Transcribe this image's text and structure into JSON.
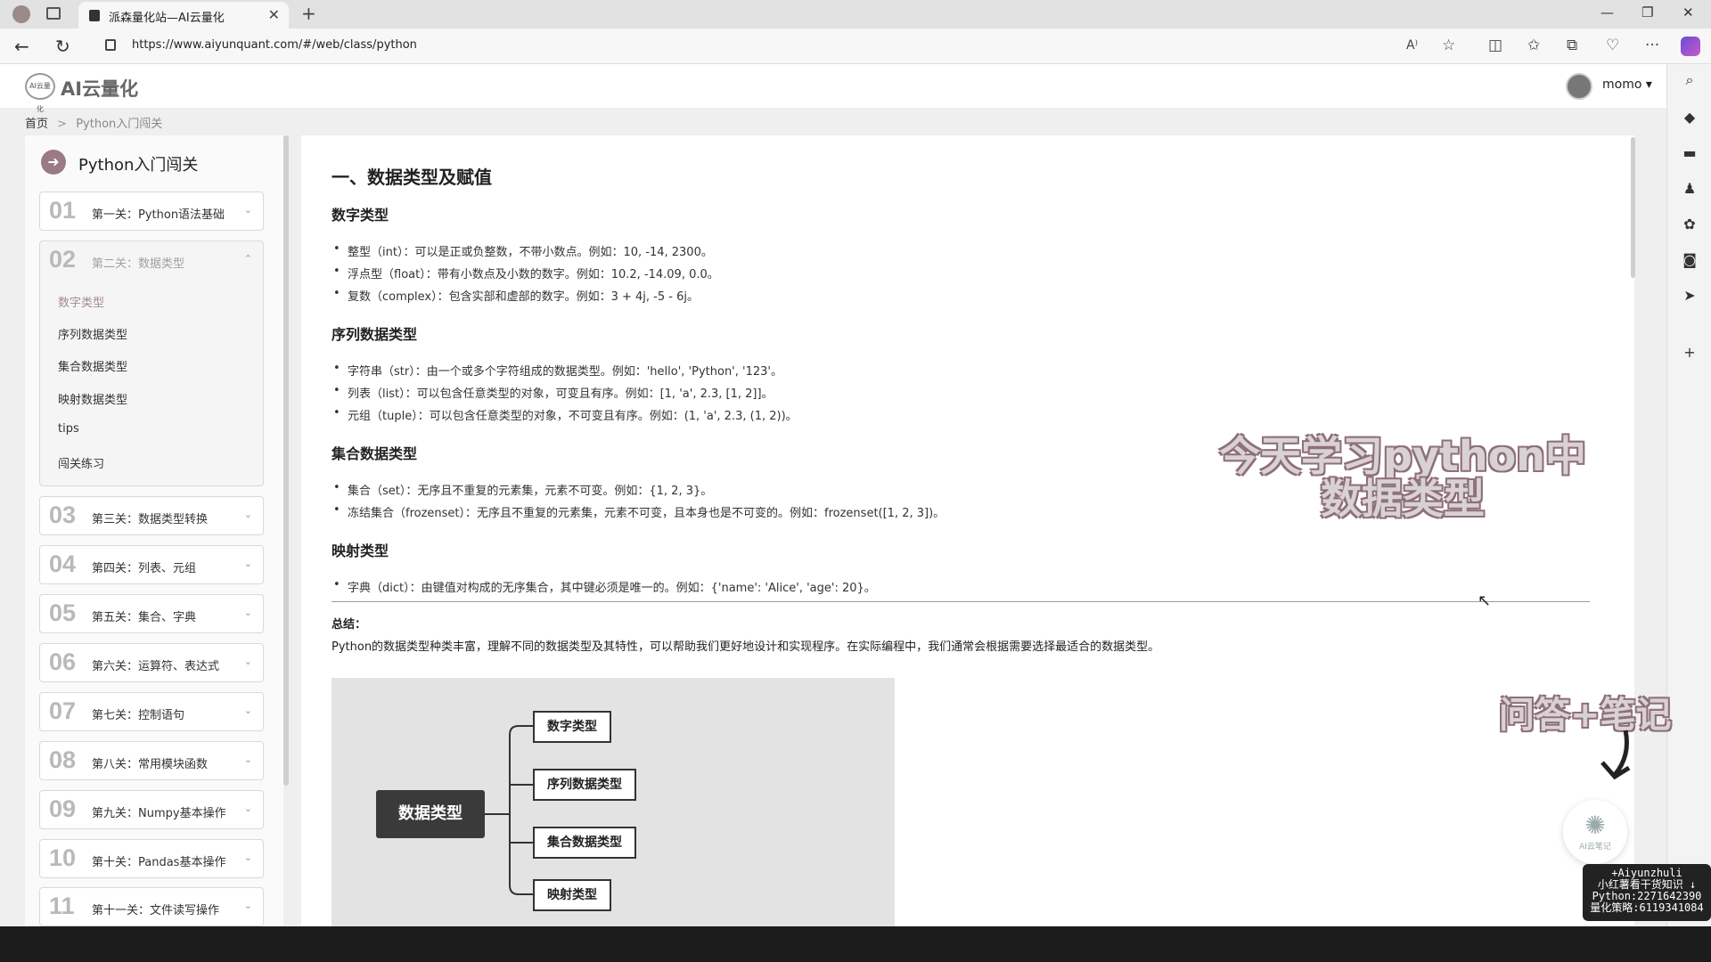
{
  "browser": {
    "tab_title": "派森量化站—AI云量化",
    "tab_close": "✕",
    "new_tab": "+",
    "url": "https://www.aiyunquant.com/#/web/class/python",
    "win_min": "—",
    "win_max": "❐",
    "win_close": "✕",
    "read_aloud": "A⁾",
    "more": "···"
  },
  "site": {
    "logo_badge": "AI云量化",
    "logo_text": "AI云量化",
    "user_name": "momo ▾"
  },
  "breadcrumb": {
    "home": "首页",
    "sep": ">",
    "current": "Python入门闯关"
  },
  "sidebar": {
    "course_title": "Python入门闯关",
    "course_arrow": "➜",
    "levels": [
      {
        "num": "01",
        "label": "第一关：Python语法基础",
        "chev": "⌄"
      },
      {
        "num": "02",
        "label": "第二关：数据类型",
        "chev": "⌃"
      },
      {
        "num": "03",
        "label": "第三关：数据类型转换",
        "chev": "⌄"
      },
      {
        "num": "04",
        "label": "第四关：列表、元组",
        "chev": "⌄"
      },
      {
        "num": "05",
        "label": "第五关：集合、字典",
        "chev": "⌄"
      },
      {
        "num": "06",
        "label": "第六关：运算符、表达式",
        "chev": "⌄"
      },
      {
        "num": "07",
        "label": "第七关：控制语句",
        "chev": "⌄"
      },
      {
        "num": "08",
        "label": "第八关：常用模块函数",
        "chev": "⌄"
      },
      {
        "num": "09",
        "label": "第九关：Numpy基本操作",
        "chev": "⌄"
      },
      {
        "num": "10",
        "label": "第十关：Pandas基本操作",
        "chev": "⌄"
      },
      {
        "num": "11",
        "label": "第十一关：文件读写操作",
        "chev": "⌄"
      }
    ],
    "subitems": [
      "数字类型",
      "序列数据类型",
      "集合数据类型",
      "映射数据类型",
      "tips",
      "闯关练习"
    ]
  },
  "content": {
    "h1": "一、数据类型及赋值",
    "sections": [
      {
        "title": "数字类型",
        "items": [
          "整型（int）：可以是正或负整数，不带小数点。例如：10, -14, 2300。",
          "浮点型（float）：带有小数点及小数的数字。例如：10.2, -14.09, 0.0。",
          "复数（complex）：包含实部和虚部的数字。例如：3 + 4j, -5 - 6j。"
        ]
      },
      {
        "title": "序列数据类型",
        "items": [
          "字符串（str）：由一个或多个字符组成的数据类型。例如：'hello', 'Python', '123'。",
          "列表（list）：可以包含任意类型的对象，可变且有序。例如：[1, 'a', 2.3, [1, 2]]。",
          "元组（tuple）：可以包含任意类型的对象，不可变且有序。例如：(1, 'a', 2.3, (1, 2))。"
        ]
      },
      {
        "title": "集合数据类型",
        "items": [
          "集合（set）：无序且不重复的元素集，元素不可变。例如：{1, 2, 3}。",
          "冻结集合（frozenset）：无序且不重复的元素集，元素不可变，且本身也是不可变的。例如：frozenset([1, 2, 3])。"
        ]
      },
      {
        "title": "映射类型",
        "items": [
          "字典（dict）：由键值对构成的无序集合，其中键必须是唯一的。例如：{'name': 'Alice', 'age': 20}。"
        ]
      }
    ],
    "summary_label": "总结：",
    "summary_text": "Python的数据类型种类丰富，理解不同的数据类型及其特性，可以帮助我们更好地设计和实现程序。在实际编程中，我们通常会根据需要选择最适合的数据类型。",
    "diagram": {
      "root": "数据类型",
      "children": [
        "数字类型",
        "序列数据类型",
        "集合数据类型",
        "映射类型"
      ]
    }
  },
  "overlays": {
    "caption_line1": "今天学习python中",
    "caption_line2": "数据类型",
    "qa": "问答+笔记",
    "ai_float_label": "AI云笔记",
    "promo_lines": [
      "+Aiyunzhuli",
      "小红薯看干货知识 ↓",
      "Python:2271642390",
      "量化策略:6119341084"
    ]
  },
  "colors": {
    "accent": "#a58a94",
    "level_number": "#b9b9b9",
    "diagram_root": "#3a3a3a"
  }
}
